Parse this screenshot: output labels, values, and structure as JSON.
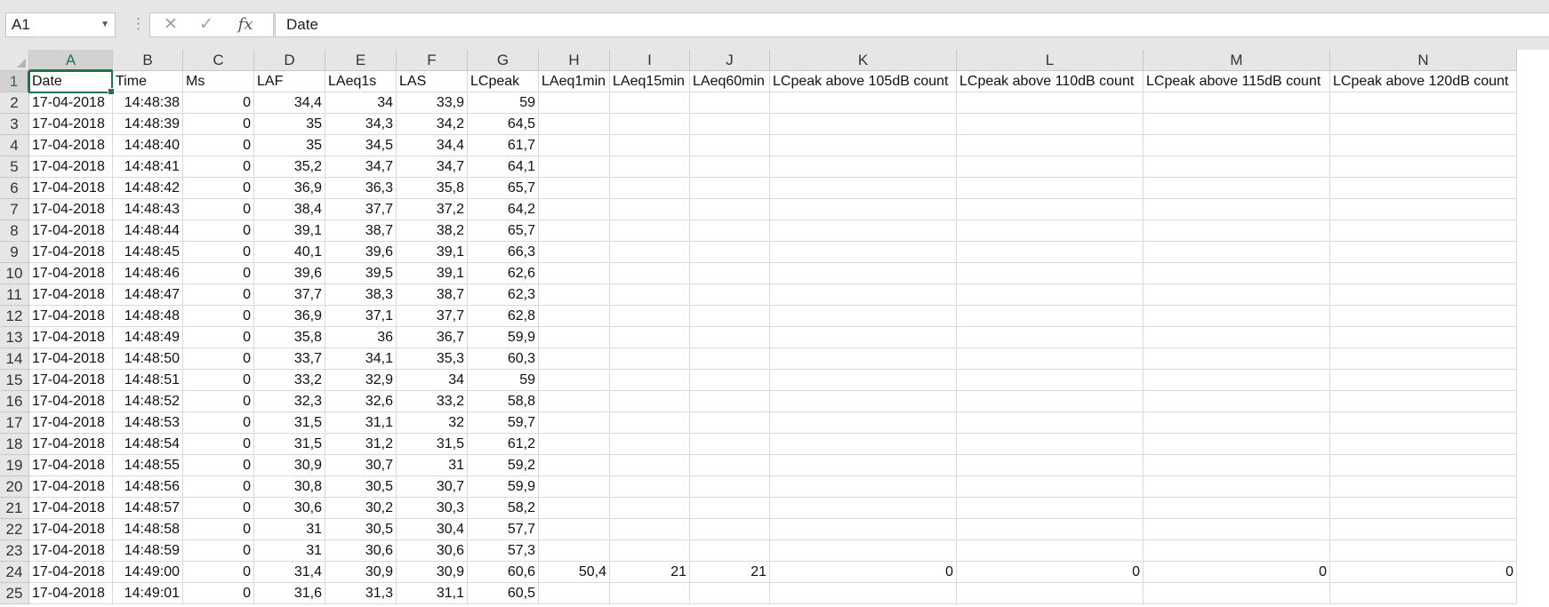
{
  "name_box": {
    "value": "A1",
    "dropdown_icon": "chevron-down-icon"
  },
  "formula_bar": {
    "value": "Date",
    "cancel_icon": "cancel-x-icon",
    "enter_icon": "checkmark-icon",
    "function_icon": "fx-icon",
    "fx_label": "fx"
  },
  "accent_color": "#217346",
  "active_cell": "A1",
  "columns": [
    "A",
    "B",
    "C",
    "D",
    "E",
    "F",
    "G",
    "H",
    "I",
    "J",
    "K",
    "L",
    "M",
    "N"
  ],
  "rows": [
    "1",
    "2",
    "3",
    "4",
    "5",
    "6",
    "7",
    "8",
    "9",
    "10",
    "11",
    "12",
    "13",
    "14",
    "15",
    "16",
    "17",
    "18",
    "19",
    "20",
    "21",
    "22",
    "23",
    "24",
    "25"
  ],
  "header_row": [
    "Date",
    "Time",
    "Ms",
    "LAF",
    "LAeq1s",
    "LAS",
    "LCpeak",
    "LAeq1min",
    "LAeq15min",
    "LAeq60min",
    "LCpeak above 105dB count",
    "LCpeak above 110dB count",
    "LCpeak above 115dB count",
    "LCpeak above 120dB count"
  ],
  "data_rows": [
    [
      "17-04-2018",
      "14:48:38",
      "0",
      "34,4",
      "34",
      "33,9",
      "59",
      "",
      "",
      "",
      "",
      "",
      "",
      ""
    ],
    [
      "17-04-2018",
      "14:48:39",
      "0",
      "35",
      "34,3",
      "34,2",
      "64,5",
      "",
      "",
      "",
      "",
      "",
      "",
      ""
    ],
    [
      "17-04-2018",
      "14:48:40",
      "0",
      "35",
      "34,5",
      "34,4",
      "61,7",
      "",
      "",
      "",
      "",
      "",
      "",
      ""
    ],
    [
      "17-04-2018",
      "14:48:41",
      "0",
      "35,2",
      "34,7",
      "34,7",
      "64,1",
      "",
      "",
      "",
      "",
      "",
      "",
      ""
    ],
    [
      "17-04-2018",
      "14:48:42",
      "0",
      "36,9",
      "36,3",
      "35,8",
      "65,7",
      "",
      "",
      "",
      "",
      "",
      "",
      ""
    ],
    [
      "17-04-2018",
      "14:48:43",
      "0",
      "38,4",
      "37,7",
      "37,2",
      "64,2",
      "",
      "",
      "",
      "",
      "",
      "",
      ""
    ],
    [
      "17-04-2018",
      "14:48:44",
      "0",
      "39,1",
      "38,7",
      "38,2",
      "65,7",
      "",
      "",
      "",
      "",
      "",
      "",
      ""
    ],
    [
      "17-04-2018",
      "14:48:45",
      "0",
      "40,1",
      "39,6",
      "39,1",
      "66,3",
      "",
      "",
      "",
      "",
      "",
      "",
      ""
    ],
    [
      "17-04-2018",
      "14:48:46",
      "0",
      "39,6",
      "39,5",
      "39,1",
      "62,6",
      "",
      "",
      "",
      "",
      "",
      "",
      ""
    ],
    [
      "17-04-2018",
      "14:48:47",
      "0",
      "37,7",
      "38,3",
      "38,7",
      "62,3",
      "",
      "",
      "",
      "",
      "",
      "",
      ""
    ],
    [
      "17-04-2018",
      "14:48:48",
      "0",
      "36,9",
      "37,1",
      "37,7",
      "62,8",
      "",
      "",
      "",
      "",
      "",
      "",
      ""
    ],
    [
      "17-04-2018",
      "14:48:49",
      "0",
      "35,8",
      "36",
      "36,7",
      "59,9",
      "",
      "",
      "",
      "",
      "",
      "",
      ""
    ],
    [
      "17-04-2018",
      "14:48:50",
      "0",
      "33,7",
      "34,1",
      "35,3",
      "60,3",
      "",
      "",
      "",
      "",
      "",
      "",
      ""
    ],
    [
      "17-04-2018",
      "14:48:51",
      "0",
      "33,2",
      "32,9",
      "34",
      "59",
      "",
      "",
      "",
      "",
      "",
      "",
      ""
    ],
    [
      "17-04-2018",
      "14:48:52",
      "0",
      "32,3",
      "32,6",
      "33,2",
      "58,8",
      "",
      "",
      "",
      "",
      "",
      "",
      ""
    ],
    [
      "17-04-2018",
      "14:48:53",
      "0",
      "31,5",
      "31,1",
      "32",
      "59,7",
      "",
      "",
      "",
      "",
      "",
      "",
      ""
    ],
    [
      "17-04-2018",
      "14:48:54",
      "0",
      "31,5",
      "31,2",
      "31,5",
      "61,2",
      "",
      "",
      "",
      "",
      "",
      "",
      ""
    ],
    [
      "17-04-2018",
      "14:48:55",
      "0",
      "30,9",
      "30,7",
      "31",
      "59,2",
      "",
      "",
      "",
      "",
      "",
      "",
      ""
    ],
    [
      "17-04-2018",
      "14:48:56",
      "0",
      "30,8",
      "30,5",
      "30,7",
      "59,9",
      "",
      "",
      "",
      "",
      "",
      "",
      ""
    ],
    [
      "17-04-2018",
      "14:48:57",
      "0",
      "30,6",
      "30,2",
      "30,3",
      "58,2",
      "",
      "",
      "",
      "",
      "",
      "",
      ""
    ],
    [
      "17-04-2018",
      "14:48:58",
      "0",
      "31",
      "30,5",
      "30,4",
      "57,7",
      "",
      "",
      "",
      "",
      "",
      "",
      ""
    ],
    [
      "17-04-2018",
      "14:48:59",
      "0",
      "31",
      "30,6",
      "30,6",
      "57,3",
      "",
      "",
      "",
      "",
      "",
      "",
      ""
    ],
    [
      "17-04-2018",
      "14:49:00",
      "0",
      "31,4",
      "30,9",
      "30,9",
      "60,6",
      "50,4",
      "21",
      "21",
      "0",
      "0",
      "0",
      "0"
    ],
    [
      "17-04-2018",
      "14:49:01",
      "0",
      "31,6",
      "31,3",
      "31,1",
      "60,5",
      "",
      "",
      "",
      "",
      "",
      "",
      ""
    ]
  ]
}
